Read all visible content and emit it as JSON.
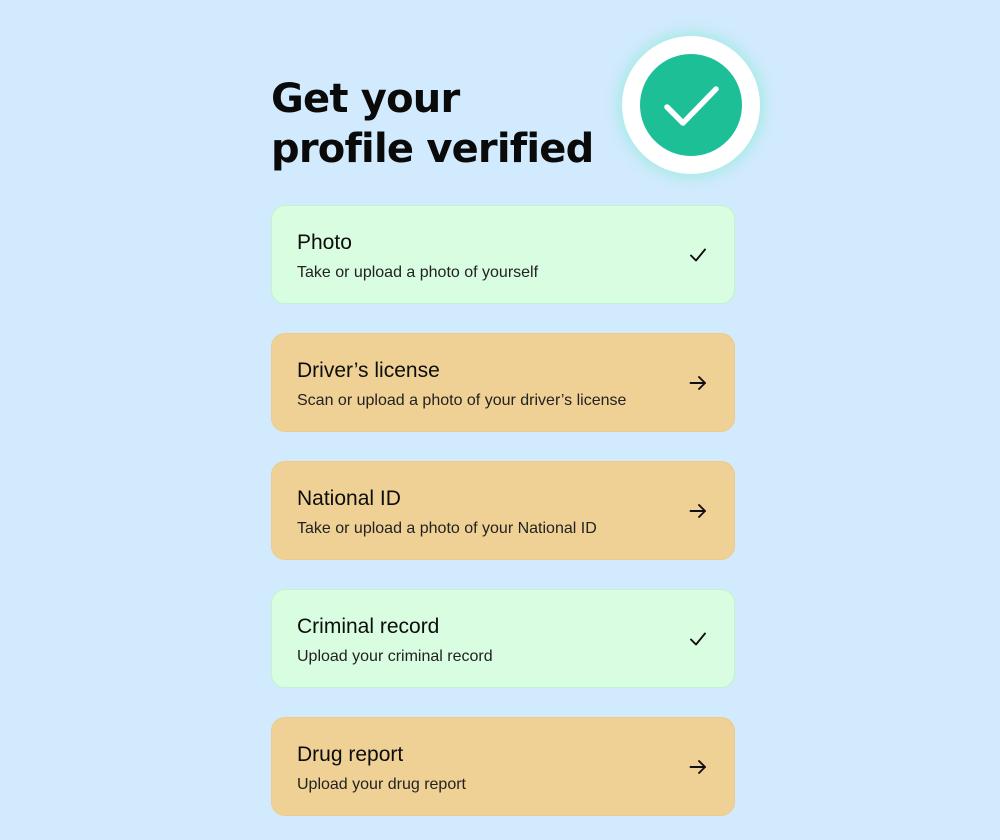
{
  "header": {
    "title": "Get your profile verified",
    "badge_icon": "check-circle-icon"
  },
  "colors": {
    "background": "#d2eafd",
    "badge_green": "#1dbf97",
    "done_card": "#d8fde0",
    "pending_card": "#f0d195"
  },
  "steps": [
    {
      "title": "Photo",
      "subtitle": "Take or upload a photo of yourself",
      "status": "done",
      "icon": "checkmark-icon"
    },
    {
      "title": "Driver’s license",
      "subtitle": "Scan or upload a photo of your driver’s license",
      "status": "pending",
      "icon": "arrow-right-icon"
    },
    {
      "title": "National ID",
      "subtitle": "Take or upload a photo of your National ID",
      "status": "pending",
      "icon": "arrow-right-icon"
    },
    {
      "title": "Criminal record",
      "subtitle": "Upload your criminal record",
      "status": "done",
      "icon": "checkmark-icon"
    },
    {
      "title": "Drug report",
      "subtitle": "Upload your drug report",
      "status": "pending",
      "icon": "arrow-right-icon"
    }
  ]
}
